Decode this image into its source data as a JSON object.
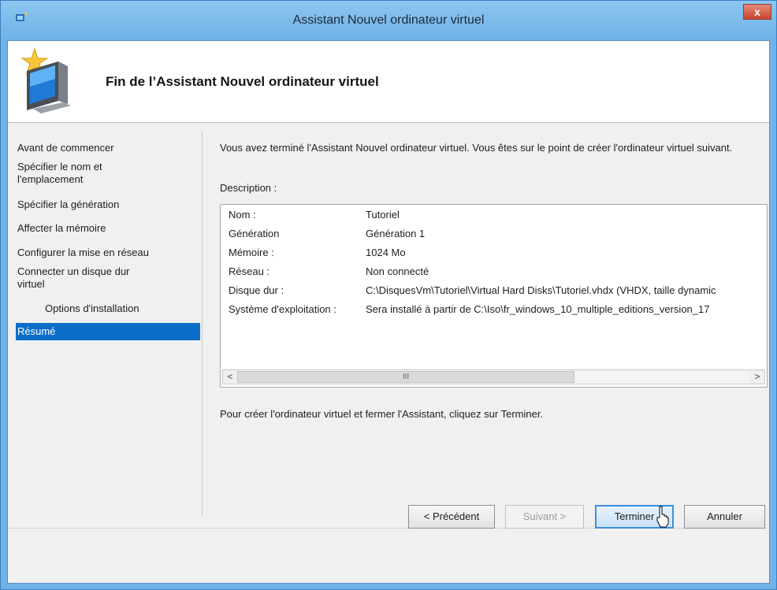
{
  "window": {
    "title": "Assistant Nouvel ordinateur virtuel",
    "close_glyph": "x"
  },
  "header": {
    "title": "Fin de l’Assistant Nouvel ordinateur virtuel"
  },
  "nav": {
    "items": [
      {
        "label": "Avant de commencer"
      },
      {
        "label": "Spécifier le nom et\nl'emplacement"
      },
      {
        "label": "Spécifier la génération"
      },
      {
        "label": "Affecter la mémoire"
      },
      {
        "label": "Configurer la mise en réseau"
      },
      {
        "label": "Connecter un disque dur\nvirtuel"
      },
      {
        "label": "Options d'installation"
      },
      {
        "label": "Résumé",
        "selected": true
      }
    ]
  },
  "main": {
    "intro": "Vous avez terminé l'Assistant Nouvel ordinateur virtuel. Vous êtes sur le point de créer l'ordinateur virtuel suivant.",
    "description_label": "Description :",
    "summary": [
      {
        "key": "Nom :",
        "value": "Tutoriel"
      },
      {
        "key": "Génération",
        "value": "Génération 1"
      },
      {
        "key": "Mémoire :",
        "value": "1024 Mo"
      },
      {
        "key": "Réseau :",
        "value": "Non connecté"
      },
      {
        "key": "Disque dur :",
        "value": "C:\\DisquesVm\\Tutoriel\\Virtual Hard Disks\\Tutoriel.vhdx (VHDX, taille dynamic"
      },
      {
        "key": "Système d'exploitation :",
        "value": "Sera installé à partir de C:\\Iso\\fr_windows_10_multiple_editions_version_17"
      }
    ],
    "scroll_left": "<",
    "scroll_right": ">",
    "scroll_grip": "III",
    "finish_note": "Pour créer l'ordinateur virtuel et fermer l'Assistant, cliquez sur Terminer."
  },
  "buttons": {
    "previous": "< Précédent",
    "next": "Suivant >",
    "finish": "Terminer",
    "cancel": "Annuler"
  },
  "colors": {
    "title_bar": "#6eb2e6",
    "selection": "#0a6ec8",
    "close": "#c8452d"
  },
  "icons": {
    "app": "hyper-v-icon",
    "header": "new-virtual-machine-icon",
    "close": "close-icon"
  }
}
